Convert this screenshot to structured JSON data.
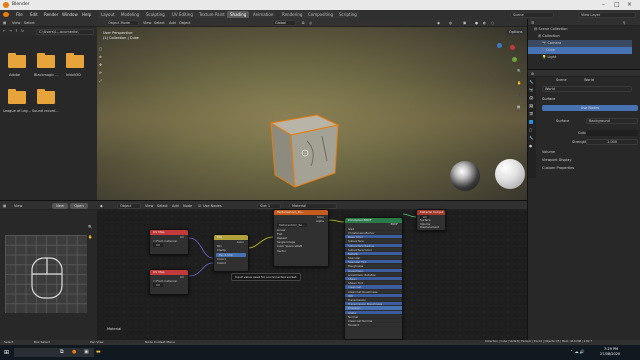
{
  "app": {
    "title": "Blender"
  },
  "menus": [
    "File",
    "Edit",
    "Render",
    "Window",
    "Help"
  ],
  "workspaces": [
    "Layout",
    "Modeling",
    "Sculpting",
    "UV Editing",
    "Texture Paint",
    "Shading",
    "Animation",
    "Rendering",
    "Compositing",
    "Scripting"
  ],
  "active_workspace": "Shading",
  "scene": {
    "label": "Scene",
    "view_layer": "View Layer"
  },
  "file_browser": {
    "header": {
      "view": "View",
      "select": "Select"
    },
    "path": "C:\\Users\\L...ocuments\\",
    "folders": [
      "Adobe",
      "Blackmagic ...",
      "Inkbit3D",
      "League of Leg...",
      "Sound record..."
    ]
  },
  "viewport": {
    "header": {
      "mode": "Object Mode",
      "view": "View",
      "select": "Select",
      "add": "Add",
      "object": "Object",
      "orientation": "Global",
      "options": "Options"
    },
    "overlay_line1": "User Perspective",
    "overlay_line2": "(1) Collection | Cube"
  },
  "image_editor": {
    "view": "View",
    "new": "New",
    "open": "Open"
  },
  "node_editor": {
    "header": {
      "object": "Object",
      "view": "View",
      "select": "Select",
      "add": "Add",
      "node": "Node",
      "use_nodes": "Use Nodes",
      "slot": "Slot 1",
      "material": "Material"
    },
    "footer_label": "Material",
    "tooltip": "Input value used for unconnected socket.",
    "nodes": {
      "uv_map_1": {
        "title": "UV Map",
        "uv": "UV",
        "from_instancer": "From Instancer",
        "value": "UV"
      },
      "uv_map_2": {
        "title": "UV Map",
        "uv": "UV",
        "from_instancer": "From Instancer",
        "value": "UV"
      },
      "mix": {
        "title": "Mix",
        "out": "Color",
        "rows": [
          "Mix",
          "Clamp",
          "Fac",
          "Color1",
          "Color2"
        ],
        "fac_value": "0.500"
      },
      "image_tex": {
        "title": "TexturesCom_Ro...",
        "out_color": "Color",
        "out_alpha": "Alpha",
        "image": "TexturesCom_Ro...",
        "rows": [
          "Linear",
          "Flat",
          "Repeat",
          "Single Image",
          "Color Space",
          "sRGB",
          "Vector"
        ]
      },
      "bsdf": {
        "title": "Principled BSDF",
        "out": "BSDF",
        "rows": [
          "GGX",
          "Christensen-Burley",
          "Base Color",
          "Subsurface",
          "Subsurface Radius",
          "Subsurface Color",
          "Metallic",
          "Specular",
          "Specular Tint",
          "Roughness",
          "Anisotropic",
          "Anisotropic Rotation",
          "Sheen",
          "Sheen Tint",
          "Clearcoat",
          "Clearcoat Roughness",
          "IOR",
          "Transmission",
          "Transmission Roughness",
          "Emission",
          "Alpha",
          "Normal",
          "Clearcoat Normal",
          "Tangent"
        ]
      },
      "output": {
        "title": "Material Output",
        "target": "All",
        "rows": [
          "Surface",
          "Volume",
          "Displacement"
        ]
      }
    }
  },
  "outliner": {
    "title": "Scene Collection",
    "items": [
      {
        "label": "Collection",
        "icon": "collection-icon"
      },
      {
        "label": "Camera",
        "icon": "camera-icon"
      },
      {
        "label": "Cube",
        "icon": "mesh-icon"
      },
      {
        "label": "Light",
        "icon": "light-icon"
      }
    ]
  },
  "properties": {
    "scene_tab": "Scene",
    "world_tab": "World",
    "world_name": "World",
    "surface_panel": "Surface",
    "use_nodes": "Use Nodes",
    "surface_label": "Surface",
    "surface_value": "Background",
    "color_label": "Color",
    "strength_label": "Strength",
    "strength_value": "1.000",
    "panels": [
      "Volume",
      "Viewport Display",
      "Custom Properties"
    ]
  },
  "statusbar": {
    "left": [
      "Select",
      "Box Select",
      "Pan View",
      "Node Context Menu"
    ],
    "right": "Collection | Cube | Verts:8 | Faces:6 | Tris:12 | Objects:1/3 | Mem: 44.6 MiB | 2.82.7"
  },
  "taskbar": {
    "time": "7:29 PM",
    "date": "27/08/2020"
  },
  "colors": {
    "accent": "#e87d0d",
    "selection": "#4772b3",
    "uv_node": "#c23a3a",
    "mix_node": "#b0a13a",
    "tex_node": "#c55c1e",
    "bsdf_node": "#2a7a4a",
    "output_node": "#a33a2a"
  }
}
